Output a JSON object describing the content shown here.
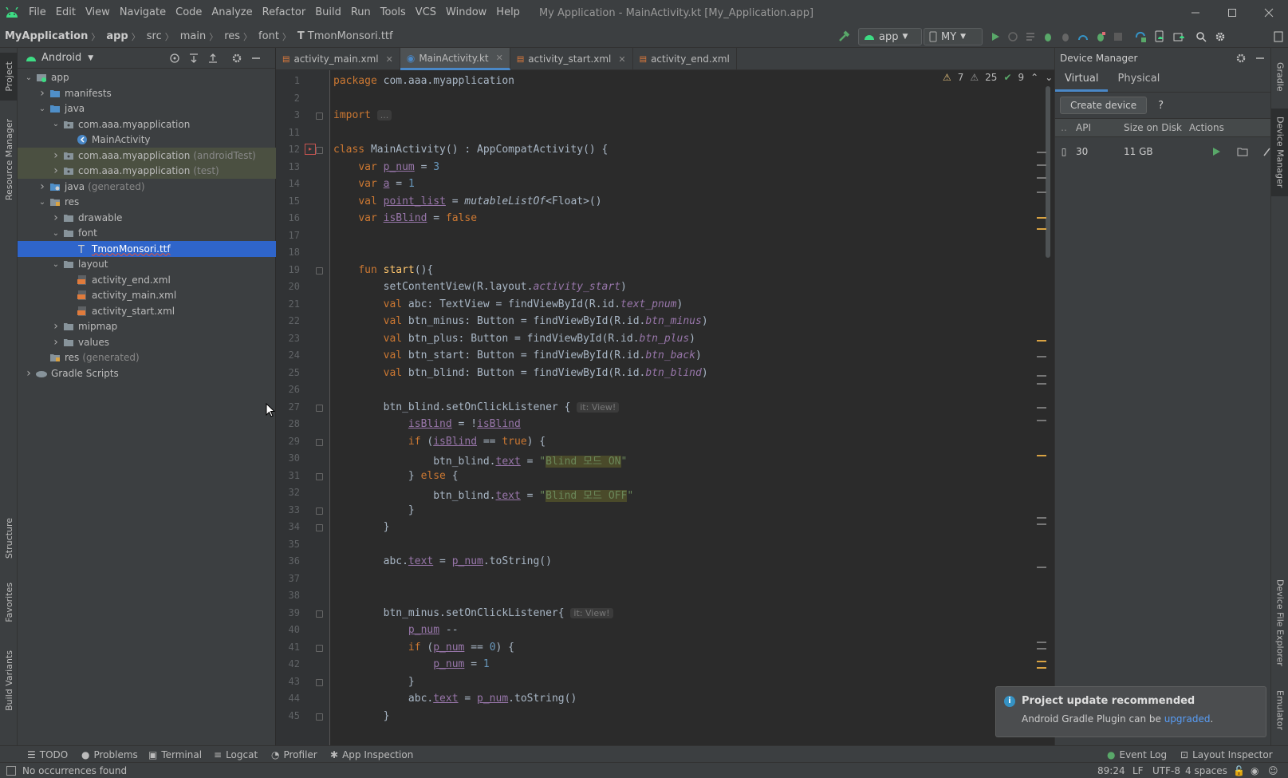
{
  "menu": {
    "items": [
      "File",
      "Edit",
      "View",
      "Navigate",
      "Code",
      "Analyze",
      "Refactor",
      "Build",
      "Run",
      "Tools",
      "VCS",
      "Window",
      "Help"
    ],
    "window_title": "My Application - MainActivity.kt [My_Application.app]"
  },
  "breadcrumb": [
    "MyApplication",
    "app",
    "src",
    "main",
    "res",
    "font",
    "TmonMonsori.ttf"
  ],
  "toolbar": {
    "run_config": "app",
    "device": "MY"
  },
  "project": {
    "view_mode": "Android",
    "tree": [
      {
        "label": "app",
        "depth": 0,
        "arrow": "down",
        "icon": "module",
        "sel": false,
        "hlt": false
      },
      {
        "label": "manifests",
        "depth": 1,
        "arrow": "right",
        "icon": "folder-blue",
        "sel": false,
        "hlt": false
      },
      {
        "label": "java",
        "depth": 1,
        "arrow": "down",
        "icon": "folder-blue",
        "sel": false,
        "hlt": false
      },
      {
        "label": "com.aaa.myapplication",
        "depth": 2,
        "arrow": "down",
        "icon": "package",
        "sel": false,
        "hlt": false
      },
      {
        "label": "MainActivity",
        "depth": 3,
        "arrow": "",
        "icon": "kotlin-class",
        "sel": false,
        "hlt": false
      },
      {
        "label": "com.aaa.myapplication",
        "suffix": "(androidTest)",
        "depth": 2,
        "arrow": "right",
        "icon": "package",
        "sel": false,
        "hlt": true
      },
      {
        "label": "com.aaa.myapplication",
        "suffix": "(test)",
        "depth": 2,
        "arrow": "right",
        "icon": "package",
        "sel": false,
        "hlt": true
      },
      {
        "label": "java",
        "suffix": "(generated)",
        "depth": 1,
        "arrow": "right",
        "icon": "folder-gen",
        "sel": false,
        "hlt": false
      },
      {
        "label": "res",
        "depth": 1,
        "arrow": "down",
        "icon": "folder-res",
        "sel": false,
        "hlt": false
      },
      {
        "label": "drawable",
        "depth": 2,
        "arrow": "right",
        "icon": "folder",
        "sel": false,
        "hlt": false
      },
      {
        "label": "font",
        "depth": 2,
        "arrow": "down",
        "icon": "folder",
        "sel": false,
        "hlt": false
      },
      {
        "label": "TmonMonsori.ttf",
        "depth": 3,
        "arrow": "",
        "icon": "font-file",
        "sel": true,
        "hlt": false
      },
      {
        "label": "layout",
        "depth": 2,
        "arrow": "down",
        "icon": "folder",
        "sel": false,
        "hlt": false
      },
      {
        "label": "activity_end.xml",
        "depth": 3,
        "arrow": "",
        "icon": "xml-file",
        "sel": false,
        "hlt": false
      },
      {
        "label": "activity_main.xml",
        "depth": 3,
        "arrow": "",
        "icon": "xml-file",
        "sel": false,
        "hlt": false
      },
      {
        "label": "activity_start.xml",
        "depth": 3,
        "arrow": "",
        "icon": "xml-file",
        "sel": false,
        "hlt": false
      },
      {
        "label": "mipmap",
        "depth": 2,
        "arrow": "right",
        "icon": "folder",
        "sel": false,
        "hlt": false
      },
      {
        "label": "values",
        "depth": 2,
        "arrow": "right",
        "icon": "folder",
        "sel": false,
        "hlt": false
      },
      {
        "label": "res",
        "suffix": "(generated)",
        "depth": 1,
        "arrow": "",
        "icon": "folder-res",
        "sel": false,
        "hlt": false
      },
      {
        "label": "Gradle Scripts",
        "depth": 0,
        "arrow": "right",
        "icon": "gradle",
        "sel": false,
        "hlt": false
      }
    ]
  },
  "editor_tabs": [
    {
      "label": "activity_main.xml",
      "active": false
    },
    {
      "label": "MainActivity.kt",
      "active": true
    },
    {
      "label": "activity_start.xml",
      "active": false
    },
    {
      "label": "activity_end.xml",
      "active": false
    }
  ],
  "inspections": {
    "warnings": "7",
    "weak_warnings": "25",
    "typos": "9"
  },
  "code_lines": [
    {
      "n": "1",
      "html": "<span class=\"k\">package</span> com.aaa.myapplication"
    },
    {
      "n": "2",
      "html": ""
    },
    {
      "n": "3",
      "html": "<span class=\"k\">import</span> <span class=\"hint\">...</span>"
    },
    {
      "n": "11",
      "html": ""
    },
    {
      "n": "12",
      "html": "<span class=\"k\">class</span> MainActivity() : AppCompatActivity() {"
    },
    {
      "n": "13",
      "html": "    <span class=\"k\">var</span> <span class=\"pv\">p_num</span> = <span class=\"n\">3</span>"
    },
    {
      "n": "14",
      "html": "    <span class=\"k\">var</span> <span class=\"pv\">a</span> = <span class=\"n\">1</span>"
    },
    {
      "n": "15",
      "html": "    <span class=\"k\">val</span> <span class=\"pv\">point_list</span> = <i>mutableListOf</i>&lt;Float&gt;()"
    },
    {
      "n": "16",
      "html": "    <span class=\"k\">var</span> <span class=\"pv\">isBlind</span> = <span class=\"k\">false</span>"
    },
    {
      "n": "17",
      "html": ""
    },
    {
      "n": "18",
      "html": ""
    },
    {
      "n": "19",
      "html": "    <span class=\"k\">fun</span> <span class=\"f\">start</span>(){"
    },
    {
      "n": "20",
      "html": "        setContentView(R.layout.<span class=\"it\">activity_start</span>)"
    },
    {
      "n": "21",
      "html": "        <span class=\"k\">val</span> abc: TextView = findViewById(R.id.<span class=\"it\">text_pnum</span>)"
    },
    {
      "n": "22",
      "html": "        <span class=\"k\">val</span> btn_minus: Button = findViewById(R.id.<span class=\"it\">btn_minus</span>)"
    },
    {
      "n": "23",
      "html": "        <span class=\"k\">val</span> btn_plus: Button = findViewById(R.id.<span class=\"it\">btn_plus</span>)"
    },
    {
      "n": "24",
      "html": "        <span class=\"k\">val</span> btn_start: Button = findViewById(R.id.<span class=\"it\">btn_back</span>)"
    },
    {
      "n": "25",
      "html": "        <span class=\"k\">val</span> btn_blind: Button = findViewById(R.id.<span class=\"it\">btn_blind</span>)"
    },
    {
      "n": "26",
      "html": ""
    },
    {
      "n": "27",
      "html": "        btn_blind.setOnClickListener { <span class=\"hint\">it: View!</span>"
    },
    {
      "n": "28",
      "html": "            <span class=\"pv\">isBlind</span> = !<span class=\"pv\">isBlind</span>"
    },
    {
      "n": "29",
      "html": "            <span class=\"k\">if</span> (<span class=\"pv\">isBlind</span> == <span class=\"k\">true</span>) {"
    },
    {
      "n": "30",
      "html": "                btn_blind.<span class=\"pv\">text</span> = <span class=\"s\">\"<span class=\"hl\">Blind 모드 ON</span>\"</span>"
    },
    {
      "n": "31",
      "html": "            } <span class=\"k\">else</span> {"
    },
    {
      "n": "32",
      "html": "                btn_blind.<span class=\"pv\">text</span> = <span class=\"s\">\"<span class=\"hl\">Blind 모드 OFF</span>\"</span>"
    },
    {
      "n": "33",
      "html": "            }"
    },
    {
      "n": "34",
      "html": "        }"
    },
    {
      "n": "35",
      "html": ""
    },
    {
      "n": "36",
      "html": "        abc.<span class=\"pv\">text</span> = <span class=\"pv\">p_num</span>.toString()"
    },
    {
      "n": "37",
      "html": ""
    },
    {
      "n": "38",
      "html": ""
    },
    {
      "n": "39",
      "html": "        btn_minus.setOnClickListener{ <span class=\"hint\">it: View!</span>"
    },
    {
      "n": "40",
      "html": "            <span class=\"pv\">p_num</span> --"
    },
    {
      "n": "41",
      "html": "            <span class=\"k\">if</span> (<span class=\"pv\">p_num</span> == <span class=\"n\">0</span>) {"
    },
    {
      "n": "42",
      "html": "                <span class=\"pv\">p_num</span> = <span class=\"n\">1</span>"
    },
    {
      "n": "43",
      "html": "            }"
    },
    {
      "n": "44",
      "html": "            abc.<span class=\"pv\">text</span> = <span class=\"pv\">p_num</span>.toString()"
    },
    {
      "n": "45",
      "html": "        }"
    }
  ],
  "device_manager": {
    "title": "Device Manager",
    "tabs": [
      "Virtual",
      "Physical"
    ],
    "create_label": "Create device",
    "help": "?",
    "columns": [
      "API",
      "Size on Disk",
      "Actions"
    ],
    "row": {
      "api": "30",
      "size": "11 GB"
    }
  },
  "right_strip": [
    "Gradle",
    "Device Manager",
    "Device File Explorer",
    "Emulator"
  ],
  "left_strip": [
    "Project",
    "Resource Manager",
    "Structure",
    "Favorites",
    "Build Variants"
  ],
  "tool_windows": [
    "TODO",
    "Problems",
    "Terminal",
    "Logcat",
    "Profiler",
    "App Inspection"
  ],
  "tool_windows_right": [
    "Event Log",
    "Layout Inspector"
  ],
  "notification": {
    "title": "Project update recommended",
    "body": "Android Gradle Plugin can be",
    "link": "upgraded",
    "end": "."
  },
  "status": {
    "message": "No occurrences found",
    "position": "89:24",
    "line_sep": "LF",
    "encoding": "UTF-8",
    "indent": "4 spaces"
  }
}
